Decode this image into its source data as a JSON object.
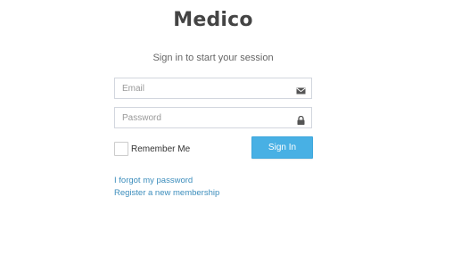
{
  "brand": {
    "logo_text": "Medico"
  },
  "login": {
    "subtitle": "Sign in to start your session",
    "email": {
      "placeholder": "Email",
      "value": "",
      "icon": "envelope-icon"
    },
    "password": {
      "placeholder": "Password",
      "value": "",
      "icon": "lock-icon"
    },
    "remember_me": {
      "label": "Remember Me",
      "checked": false
    },
    "submit_label": "Sign In",
    "forgot_link": "I forgot my password",
    "register_link": "Register a new membership"
  },
  "colors": {
    "accent": "#48b0e4",
    "link": "#3c8dbc",
    "logo": "#444444"
  }
}
